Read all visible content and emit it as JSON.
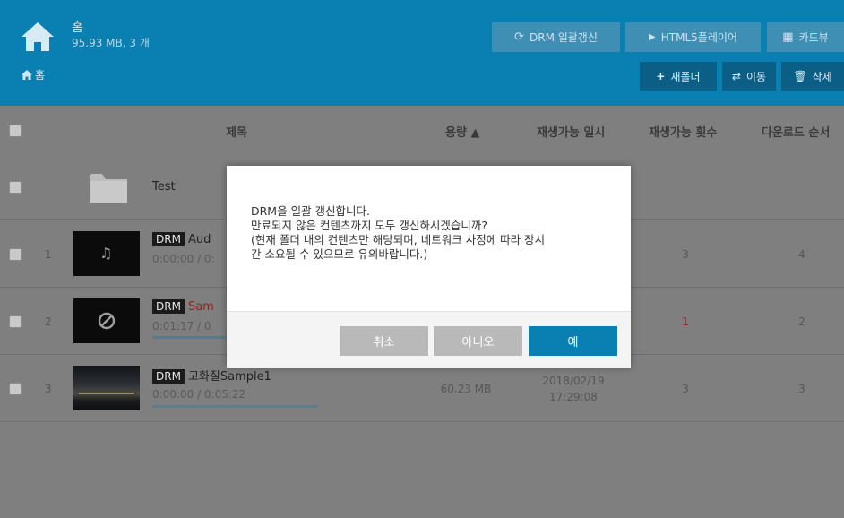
{
  "header": {
    "title": "홈",
    "subtitle": "95.93 MB, 3 개",
    "breadcrumb": "홈",
    "buttons": {
      "drm_refresh": "DRM 일괄갱신",
      "html5_player": "HTML5플레이어",
      "card_view": "카드뷰",
      "new_folder": "새폴더",
      "move": "이동",
      "delete": "삭제"
    }
  },
  "table": {
    "columns": {
      "title": "제목",
      "size": "용량 ▲",
      "playable_until": "재생가능 일시",
      "play_count": "재생가능 횟수",
      "download_order": "다운로드 순서"
    },
    "folder": {
      "name": "Test"
    },
    "rows": [
      {
        "num": "1",
        "drm": "DRM",
        "title": "Aud",
        "time": "0:00:00 / 0:",
        "play_count": "3",
        "download_order": "4"
      },
      {
        "num": "2",
        "drm": "DRM",
        "title": "Sam",
        "time": "0:01:17 / 0",
        "play_count": "1",
        "download_order": "2"
      },
      {
        "num": "3",
        "drm": "DRM",
        "title": "고화질Sample1",
        "time": "0:00:00 / 0:05:22",
        "size": "60.23 MB",
        "date": "2018/02/19",
        "clock": "17:29:08",
        "play_count": "3",
        "download_order": "3"
      }
    ]
  },
  "dialog": {
    "line1": "DRM을 일괄 갱신합니다.",
    "line2": "만료되지 않은 컨텐츠까지 모두 갱신하시겠습니까?",
    "line3": "(현재 폴더 내의 컨텐츠만 해당되며, 네트워크 사정에 따라 장시",
    "line4": "간 소요될 수 있으므로 유의바랍니다.)",
    "cancel": "취소",
    "no": "아니오",
    "yes": "예"
  },
  "colors": {
    "header_bg": "#0a7fb1",
    "primary_button": "#0a7fb1",
    "disabled_button": "#b9b9b9",
    "expired_red": "#c02a2a"
  }
}
